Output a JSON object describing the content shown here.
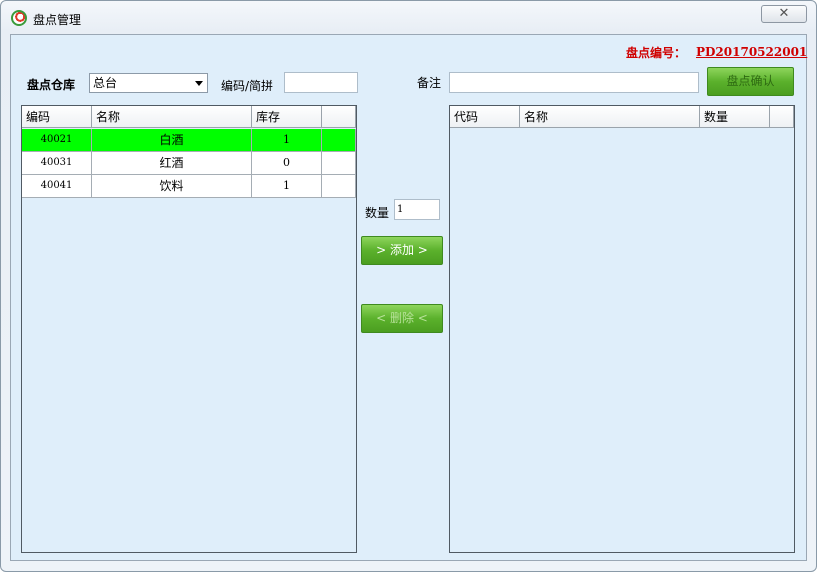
{
  "window": {
    "title": "盘点管理",
    "close_label": "✕"
  },
  "header": {
    "code_label": "盘点编号：",
    "code_value": "PD20170522001"
  },
  "filters": {
    "warehouse_label": "盘点仓库",
    "warehouse_selected": "总台",
    "code_pinyin_label": "编码/简拼",
    "code_pinyin_value": "",
    "note_label": "备注",
    "note_value": ""
  },
  "actions": {
    "confirm_label": "盘点确认",
    "add_label": "> 添加 >",
    "delete_label": "< 删除 <",
    "quantity_label": "数量",
    "quantity_value": "1"
  },
  "left_grid": {
    "columns": [
      "编码",
      "名称",
      "库存",
      ""
    ],
    "rows": [
      {
        "code": "40021",
        "name": "白酒",
        "stock": "1",
        "selected": true
      },
      {
        "code": "40031",
        "name": "红酒",
        "stock": "0",
        "selected": false
      },
      {
        "code": "40041",
        "name": "饮料",
        "stock": "1",
        "selected": false
      }
    ]
  },
  "right_grid": {
    "columns": [
      "代码",
      "名称",
      "数量",
      ""
    ],
    "rows": []
  },
  "colors": {
    "accent_red": "#d00000",
    "selected_row": "#00ff00",
    "button_green": "#5bb12c",
    "client_bg": "#dfeefa"
  }
}
